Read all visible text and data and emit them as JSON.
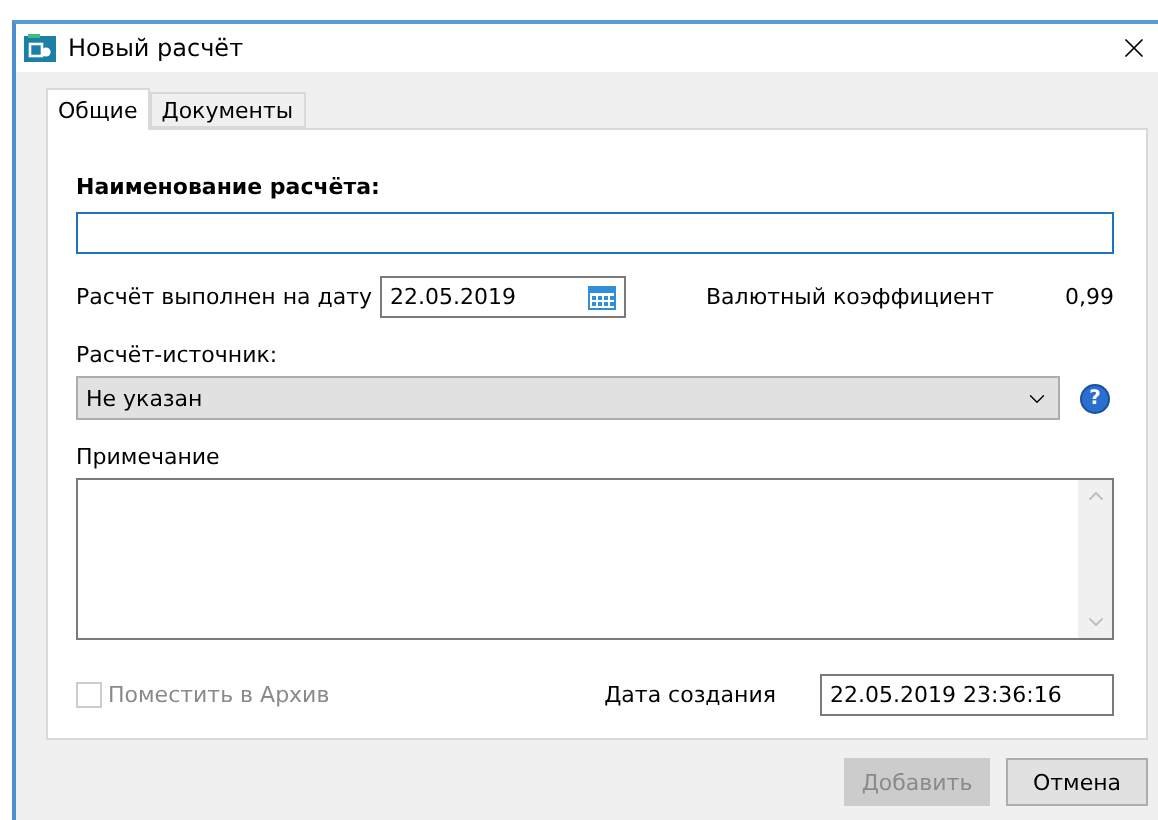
{
  "window": {
    "title": "Новый расчёт"
  },
  "tabs": [
    {
      "label": "Общие",
      "selected": true
    },
    {
      "label": "Документы",
      "selected": false
    }
  ],
  "name_field": {
    "label": "Наименование расчёта:",
    "focused": true
  },
  "date_field": {
    "label": "Расчёт выполнен на дату",
    "value": "22.05.2019"
  },
  "currency": {
    "label": "Валютный коэффициент",
    "value": "0,99"
  },
  "source": {
    "label": "Расчёт-источник:",
    "value": "Не указан"
  },
  "help": {
    "label": "?"
  },
  "note": {
    "label": "Примечание"
  },
  "archive": {
    "label": "Поместить в Архив",
    "checked": false,
    "disabled": true
  },
  "created": {
    "label": "Дата создания",
    "value": "22.05.2019 23:36:16"
  },
  "buttons": [
    {
      "label": "Добавить",
      "disabled": true
    },
    {
      "label": "Отмена",
      "disabled": false
    }
  ]
}
